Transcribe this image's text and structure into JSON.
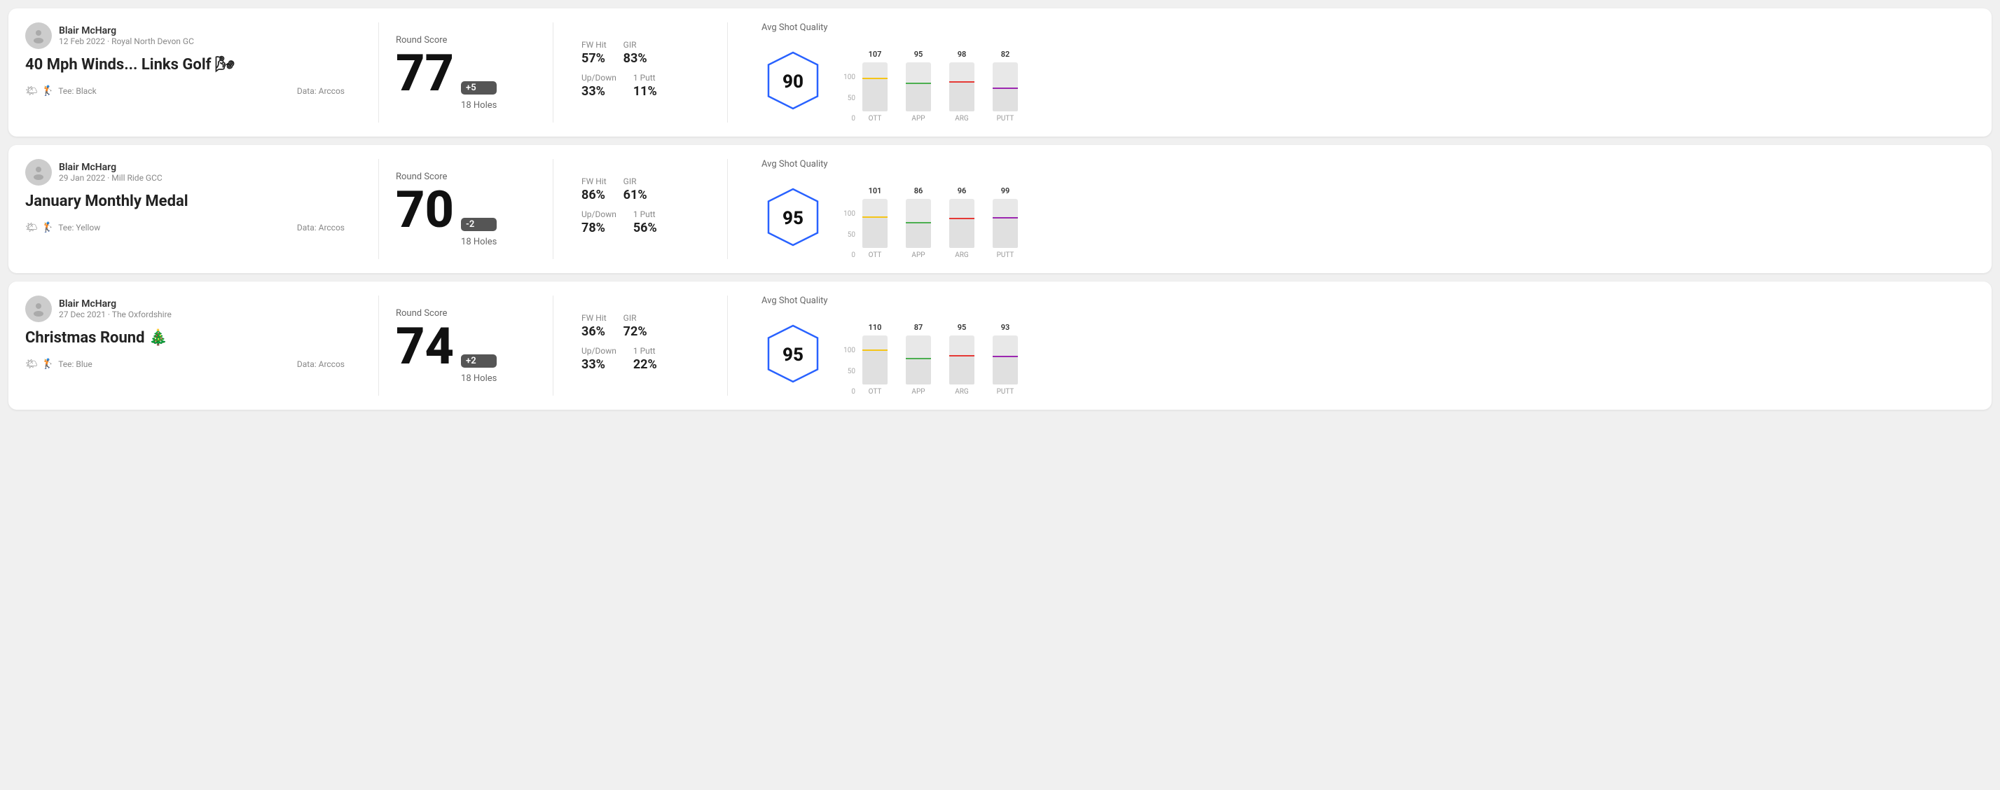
{
  "rounds": [
    {
      "id": "round-1",
      "user": {
        "name": "Blair McHarg",
        "date": "12 Feb 2022 · Royal North Devon GC"
      },
      "title": "40 Mph Winds... Links Golf 🌬",
      "tee": "Black",
      "data_source": "Data: Arccos",
      "score": {
        "label": "Round Score",
        "number": "77",
        "badge": "+5",
        "holes": "18 Holes"
      },
      "stats": {
        "fw_hit_label": "FW Hit",
        "fw_hit_value": "57%",
        "gir_label": "GIR",
        "gir_value": "83%",
        "updown_label": "Up/Down",
        "updown_value": "33%",
        "oneputt_label": "1 Putt",
        "oneputt_value": "11%"
      },
      "quality": {
        "label": "Avg Shot Quality",
        "score": "90",
        "bars": [
          {
            "label": "OTT",
            "value": 107,
            "color": "#f5c518",
            "pct": 65
          },
          {
            "label": "APP",
            "value": 95,
            "color": "#4caf50",
            "pct": 55
          },
          {
            "label": "ARG",
            "value": 98,
            "color": "#e53935",
            "pct": 58
          },
          {
            "label": "PUTT",
            "value": 82,
            "color": "#9c27b0",
            "pct": 45
          }
        ]
      }
    },
    {
      "id": "round-2",
      "user": {
        "name": "Blair McHarg",
        "date": "29 Jan 2022 · Mill Ride GCC"
      },
      "title": "January Monthly Medal",
      "tee": "Yellow",
      "data_source": "Data: Arccos",
      "score": {
        "label": "Round Score",
        "number": "70",
        "badge": "-2",
        "holes": "18 Holes"
      },
      "stats": {
        "fw_hit_label": "FW Hit",
        "fw_hit_value": "86%",
        "gir_label": "GIR",
        "gir_value": "61%",
        "updown_label": "Up/Down",
        "updown_value": "78%",
        "oneputt_label": "1 Putt",
        "oneputt_value": "56%"
      },
      "quality": {
        "label": "Avg Shot Quality",
        "score": "95",
        "bars": [
          {
            "label": "OTT",
            "value": 101,
            "color": "#f5c518",
            "pct": 62
          },
          {
            "label": "APP",
            "value": 86,
            "color": "#4caf50",
            "pct": 50
          },
          {
            "label": "ARG",
            "value": 96,
            "color": "#e53935",
            "pct": 58
          },
          {
            "label": "PUTT",
            "value": 99,
            "color": "#9c27b0",
            "pct": 60
          }
        ]
      }
    },
    {
      "id": "round-3",
      "user": {
        "name": "Blair McHarg",
        "date": "27 Dec 2021 · The Oxfordshire"
      },
      "title": "Christmas Round 🎄",
      "tee": "Blue",
      "data_source": "Data: Arccos",
      "score": {
        "label": "Round Score",
        "number": "74",
        "badge": "+2",
        "holes": "18 Holes"
      },
      "stats": {
        "fw_hit_label": "FW Hit",
        "fw_hit_value": "36%",
        "gir_label": "GIR",
        "gir_value": "72%",
        "updown_label": "Up/Down",
        "updown_value": "33%",
        "oneputt_label": "1 Putt",
        "oneputt_value": "22%"
      },
      "quality": {
        "label": "Avg Shot Quality",
        "score": "95",
        "bars": [
          {
            "label": "OTT",
            "value": 110,
            "color": "#f5c518",
            "pct": 68
          },
          {
            "label": "APP",
            "value": 87,
            "color": "#4caf50",
            "pct": 51
          },
          {
            "label": "ARG",
            "value": 95,
            "color": "#e53935",
            "pct": 57
          },
          {
            "label": "PUTT",
            "value": 93,
            "color": "#9c27b0",
            "pct": 56
          }
        ]
      }
    }
  ]
}
